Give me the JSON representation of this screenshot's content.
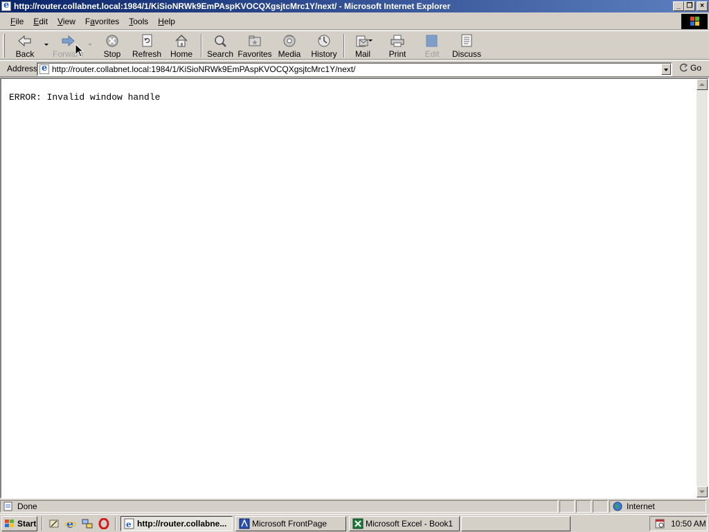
{
  "window": {
    "title": "http://router.collabnet.local:1984/1/KiSioNRWk9EmPAspKVOCQXgsjtcMrc1Y/next/ - Microsoft Internet Explorer",
    "min_glyph": "_",
    "restore_glyph": "❐",
    "close_glyph": "×"
  },
  "menu": {
    "items": [
      {
        "accel": "F",
        "rest": "ile"
      },
      {
        "accel": "E",
        "rest": "dit"
      },
      {
        "accel": "V",
        "rest": "iew"
      },
      {
        "pre": "F",
        "accel": "a",
        "rest": "vorites"
      },
      {
        "accel": "T",
        "rest": "ools"
      },
      {
        "accel": "H",
        "rest": "elp"
      }
    ]
  },
  "toolbar": {
    "back": "Back",
    "forward": "Forward",
    "stop": "Stop",
    "refresh": "Refresh",
    "home": "Home",
    "search": "Search",
    "favorites": "Favorites",
    "media": "Media",
    "history": "History",
    "mail": "Mail",
    "print": "Print",
    "edit": "Edit",
    "discuss": "Discuss"
  },
  "address": {
    "label": "Address",
    "url": "http://router.collabnet.local:1984/1/KiSioNRWk9EmPAspKVOCQXgsjtcMrc1Y/next/",
    "go": "Go"
  },
  "page": {
    "body_text": "ERROR: Invalid window handle"
  },
  "status": {
    "text": "Done",
    "zone": "Internet"
  },
  "taskbar": {
    "start": "Start",
    "tasks": [
      {
        "label": "http://router.collabne...",
        "active": true
      },
      {
        "label": "Microsoft FrontPage",
        "active": false
      },
      {
        "label": "Microsoft Excel - Book1",
        "active": false
      }
    ],
    "clock": "10:50 AM"
  },
  "colors": {
    "titlebar_start": "#0a246a",
    "titlebar_end": "#5d7fbf",
    "chrome": "#d4d0c8"
  }
}
